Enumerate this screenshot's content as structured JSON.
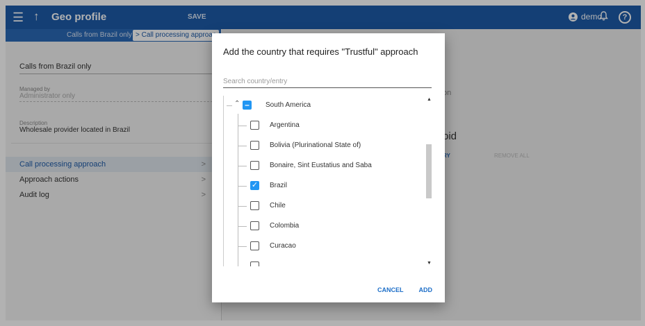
{
  "header": {
    "title": "Geo profile",
    "save_label": "SAVE",
    "user": "demo",
    "icons": [
      "menu-icon",
      "arrow-up-icon",
      "account-icon",
      "bell-icon",
      "help-icon"
    ]
  },
  "breadcrumb": {
    "items": [
      "Calls from Brazil only",
      "Call processing approac"
    ]
  },
  "profile": {
    "name": "Calls from Brazil only",
    "managed_by_label": "Managed by",
    "managed_by_value": "Administrator only",
    "description_label": "Description",
    "description_value": "Wholesale provider located in Brazil"
  },
  "nav": {
    "items": [
      {
        "label": "Call processing approach",
        "active": true
      },
      {
        "label": "Approach actions",
        "active": false
      },
      {
        "label": "Audit log",
        "active": false
      }
    ]
  },
  "background": {
    "fragment_on": "on",
    "fragment_oid": "oid",
    "fragment_ry": "RY",
    "remove_all": "REMOVE ALL"
  },
  "dialog": {
    "title": "Add the country that requires \"Trustful\" approach",
    "search_placeholder": "Search country/entry",
    "parent": {
      "label": "South America",
      "state": "indeterminate"
    },
    "countries": [
      {
        "label": "Argentina",
        "checked": false
      },
      {
        "label": "Bolivia (Plurinational State of)",
        "checked": false
      },
      {
        "label": "Bonaire, Sint Eustatius and Saba",
        "checked": false
      },
      {
        "label": "Brazil",
        "checked": true
      },
      {
        "label": "Chile",
        "checked": false
      },
      {
        "label": "Colombia",
        "checked": false
      },
      {
        "label": "Curacao",
        "checked": false
      }
    ],
    "cancel_label": "CANCEL",
    "add_label": "ADD"
  },
  "colors": {
    "topbar": "#1e5ba8",
    "accent": "#2196f3",
    "link": "#1e6fc8"
  }
}
